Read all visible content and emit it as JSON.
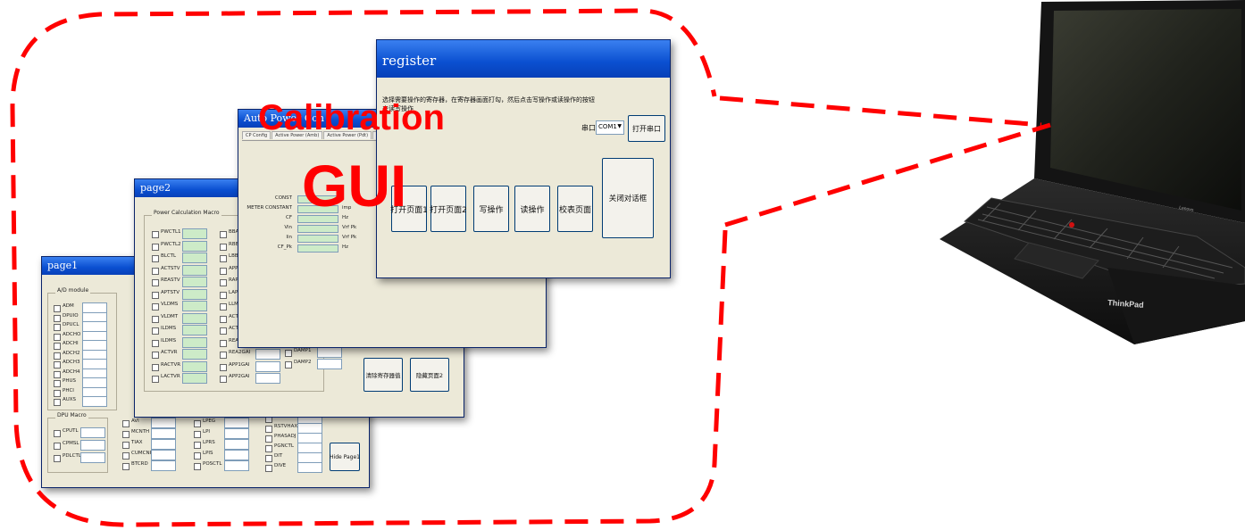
{
  "labels": {
    "calibration": "Calibration",
    "gui": "GUI"
  },
  "colors": {
    "dash": "#ff0000",
    "titlebar": "#0a4fd0",
    "window_bg": "#ece9d8",
    "highlight_field": "#cdebc8"
  },
  "win1": {
    "title": "page1",
    "group_a": {
      "title": "A/D module",
      "items": [
        "ADM",
        "DPUIO",
        "DPUCL",
        "ADCHO",
        "ADCHI",
        "ADCH2",
        "ADCH3",
        "ADCH4",
        "PHUS",
        "PHCI",
        "AUXS"
      ]
    },
    "group_b": {
      "title": "DPU Macro",
      "items": [
        "CPUTL",
        "CPMSL",
        "PDLCTL"
      ]
    },
    "col3": [
      "AVI",
      "MCNTH",
      "TIAX",
      "CUMCNR",
      "BTCRD"
    ],
    "col4": [
      "LPEG",
      "LPI",
      "LPRS",
      "LPIS",
      "POSCTL"
    ],
    "col5": [
      "VGSL",
      "RSTVHAX",
      "PHASADJ",
      "PGNCTL",
      "DIT",
      "DIVE"
    ],
    "hide_button": "Hide Page1"
  },
  "win2": {
    "title": "page2",
    "group_title": "Power Calculation Macro",
    "col1": [
      "PWCTL1",
      "PWCTL2",
      "BLCTL",
      "ACTSTV",
      "REASTV",
      "APTSTV",
      "VLDMS",
      "VLDMT",
      "ILDMS",
      "ILDMS",
      "ACTVR",
      "RACTVR",
      "LACTVR"
    ],
    "col2": [
      "BBASE",
      "RBBASE",
      "LBBASE",
      "APPVR",
      "RAPPVR",
      "LAPPVR",
      "LLMSUM",
      "ACT1GAI",
      "ACT2GAI",
      "REA1GAI",
      "REA2GAI",
      "APP1GAI",
      "APP2GAI"
    ],
    "extra": [
      "DAMP1",
      "DAMP2"
    ],
    "btn_clear": "清除寄存器值",
    "btn_hide": "隐藏页面2"
  },
  "win3": {
    "title": "Auto Power Con",
    "tabs": [
      "CP Config",
      "Active Power (Amb)",
      "Active Power (Pdt)",
      "Active Pa..."
    ],
    "rows": [
      {
        "label": "CONST",
        "unit": "",
        "val_hint": ""
      },
      {
        "label": "METER CONSTANT",
        "unit": "imp",
        "val_hint": ""
      },
      {
        "label": "CF",
        "unit": "Hz",
        "val_hint": ""
      },
      {
        "label": "Vin",
        "unit": "Vrf Pk",
        "val_hint": ""
      },
      {
        "label": "Iin",
        "unit": "Vrf Pk",
        "val_hint": ""
      },
      {
        "label": "CF_Pk",
        "unit": "Hz",
        "val_hint": ""
      }
    ]
  },
  "win4": {
    "title": "register",
    "instruction": "选择需要操作的寄存器，在寄存器画面打勾，然后点击写操作或读操作的按钮",
    "instruction2": "来读写操作",
    "port_label": "串口",
    "port_value": "COM1",
    "open_port": "打开串口",
    "buttons": [
      "打开页面1",
      "打开页面2",
      "写操作",
      "读操作",
      "校表页面"
    ],
    "close_dialog": "关闭对话框"
  },
  "laptop": {
    "brand": "ThinkPad",
    "keyboard_brand": "Lenovo"
  }
}
